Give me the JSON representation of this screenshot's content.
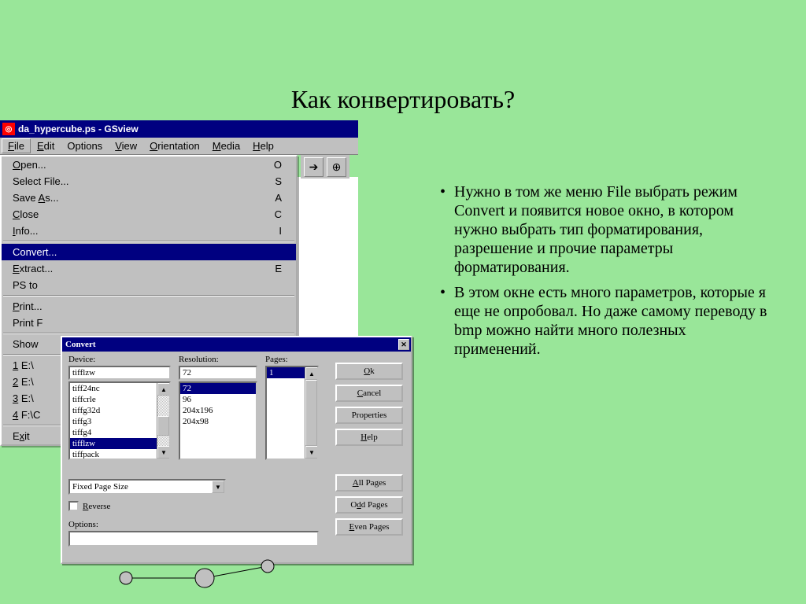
{
  "slide": {
    "title": "Как конвертировать?",
    "bullet1": "Нужно в том же меню File выбрать режим Convert и появится новое окно, в котором нужно выбрать тип форматирования, разрешение и прочие параметры форматирования.",
    "bullet2": "В этом окне есть много параметров, которые я еще не опробовал. Но даже самому переводу в bmp можно найти много полезных применений."
  },
  "app": {
    "title": "da_hypercube.ps - GSview",
    "menubar": [
      "File",
      "Edit",
      "Options",
      "View",
      "Orientation",
      "Media",
      "Help"
    ]
  },
  "menu": {
    "items": [
      {
        "label": "Open...",
        "accel": "O"
      },
      {
        "label": "Select File...",
        "accel": "S"
      },
      {
        "label": "Save As...",
        "accel": "A"
      },
      {
        "label": "Close",
        "accel": "C"
      },
      {
        "label": "Info...",
        "accel": "I"
      },
      {
        "sep": true
      },
      {
        "label": "Convert...",
        "accel": "",
        "selected": true
      },
      {
        "label": "Extract...",
        "accel": "E"
      },
      {
        "label": "PS to",
        "accel": ""
      },
      {
        "sep": true
      },
      {
        "label": "Print...",
        "accel": ""
      },
      {
        "label": "Print F",
        "accel": ""
      },
      {
        "sep": true
      },
      {
        "label": "Show",
        "accel": ""
      },
      {
        "sep": true
      },
      {
        "label": "1 E:\\",
        "accel": ""
      },
      {
        "label": "2 E:\\",
        "accel": ""
      },
      {
        "label": "3 E:\\",
        "accel": ""
      },
      {
        "label": "4 F:\\C",
        "accel": ""
      },
      {
        "sep": true
      },
      {
        "label": "Exit",
        "accel": ""
      }
    ]
  },
  "dialog": {
    "title": "Convert",
    "device_label": "Device:",
    "device_value": "tifflzw",
    "device_list": [
      "tiff24nc",
      "tiffcrle",
      "tiffg32d",
      "tiffg3",
      "tiffg4",
      "tifflzw",
      "tiffpack"
    ],
    "device_selected": "tifflzw",
    "res_label": "Resolution:",
    "res_value": "72",
    "res_list": [
      "72",
      "96",
      "204x196",
      "204x98"
    ],
    "res_selected": "72",
    "pages_label": "Pages:",
    "pages_list": [
      "1"
    ],
    "pages_selected": "1",
    "combo_value": "Fixed Page Size",
    "reverse_label": "Reverse",
    "options_label": "Options:",
    "buttons": {
      "ok": "Ok",
      "cancel": "Cancel",
      "props": "Properties",
      "help": "Help",
      "allpages": "All Pages",
      "oddpages": "Odd Pages",
      "evenpages": "Even Pages"
    }
  }
}
